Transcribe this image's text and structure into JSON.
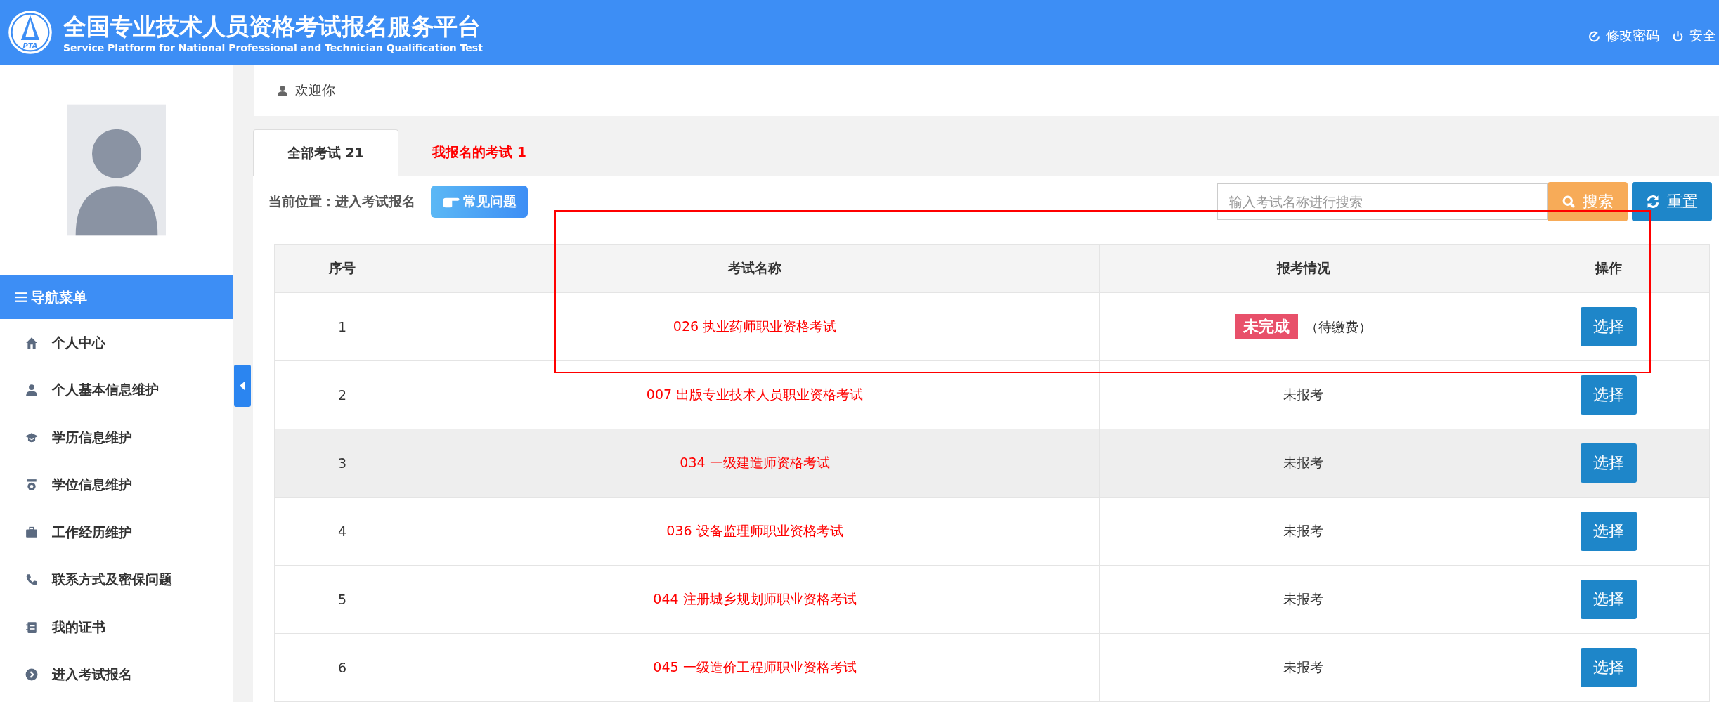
{
  "header": {
    "title": "全国专业技术人员资格考试报名服务平台",
    "subtitle": "Service Platform for National Professional and Technician Qualification Test",
    "logo_text": "PTA",
    "actions": [
      {
        "kind": "password",
        "label": "修改密码"
      },
      {
        "kind": "logout",
        "label": "安全"
      }
    ]
  },
  "sidebar": {
    "menu_title": "导航菜单",
    "items": [
      {
        "kind": "home",
        "label": "个人中心"
      },
      {
        "kind": "user",
        "label": "个人基本信息维护"
      },
      {
        "kind": "cap",
        "label": "学历信息维护"
      },
      {
        "kind": "medal",
        "label": "学位信息维护"
      },
      {
        "kind": "case",
        "label": "工作经历维护"
      },
      {
        "kind": "phone",
        "label": "联系方式及密保问题"
      },
      {
        "kind": "book",
        "label": "我的证书"
      },
      {
        "kind": "enter",
        "label": "进入考试报名"
      }
    ]
  },
  "welcome": "欢迎你",
  "tabs": [
    {
      "label": "全部考试 21",
      "selected": true
    },
    {
      "label": "我报名的考试 1",
      "selected": false
    }
  ],
  "breadcrumb": "当前位置：进入考试报名",
  "faq_button": "常见问题",
  "search": {
    "placeholder": "输入考试名称进行搜索",
    "search_button": "搜索",
    "reset_button": "重置"
  },
  "table": {
    "columns": [
      "序号",
      "考试名称",
      "报考情况",
      "操作"
    ],
    "rows": [
      {
        "no": "1",
        "name": "026 执业药师职业资格考试",
        "kind": "badge",
        "badge": "未完成",
        "status": "（待缴费）",
        "action": "选择",
        "highlighted": false
      },
      {
        "no": "2",
        "name": "007 出版专业技术人员职业资格考试",
        "kind": "text",
        "status": "未报考",
        "action": "选择",
        "highlighted": false
      },
      {
        "no": "3",
        "name": "034 一级建造师资格考试",
        "kind": "text",
        "status": "未报考",
        "action": "选择",
        "highlighted": true
      },
      {
        "no": "4",
        "name": "036 设备监理师职业资格考试",
        "kind": "text",
        "status": "未报考",
        "action": "选择",
        "highlighted": false
      },
      {
        "no": "5",
        "name": "044 注册城乡规划师职业资格考试",
        "kind": "text",
        "status": "未报考",
        "action": "选择",
        "highlighted": false
      },
      {
        "no": "6",
        "name": "045 一级造价工程师职业资格考试",
        "kind": "text",
        "status": "未报考",
        "action": "选择",
        "highlighted": false
      }
    ]
  }
}
